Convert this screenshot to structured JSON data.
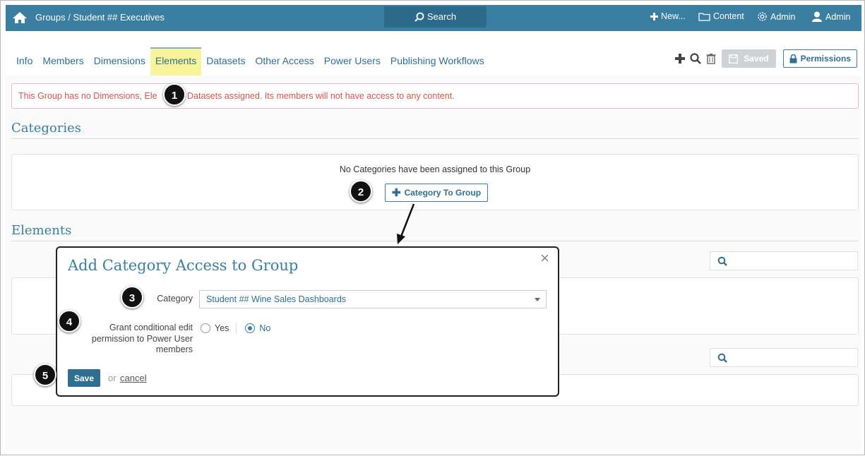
{
  "topbar": {
    "breadcrumb_root": "Groups",
    "breadcrumb_sep": " / ",
    "breadcrumb_current": "Student ## Executives",
    "search_label": "Search",
    "new_label": "New...",
    "content_label": "Content",
    "admin_label": "Admin",
    "user_label": "Admin"
  },
  "tabs": [
    {
      "label": "Info"
    },
    {
      "label": "Members"
    },
    {
      "label": "Dimensions"
    },
    {
      "label": "Elements"
    },
    {
      "label": "Datasets"
    },
    {
      "label": "Other Access"
    },
    {
      "label": "Power Users"
    },
    {
      "label": "Publishing Workflows"
    }
  ],
  "toolbar": {
    "saved_label": "Saved",
    "permissions_label": "Permissions"
  },
  "alert": {
    "text": "This Group has no Dimensions, Ele        or Datasets assigned. Its members will not have access to any content."
  },
  "categories": {
    "title": "Categories",
    "empty_text": "No Categories have been assigned to this Group",
    "add_button": "Category To Group"
  },
  "elements": {
    "title": "Elements"
  },
  "modal": {
    "title": "Add Category Access to Group",
    "category_label": "Category",
    "category_value": "Student ## Wine Sales Dashboards",
    "grant_label_1": "Grant conditional edit",
    "grant_label_2": "permission to Power User",
    "grant_label_3": "members",
    "yes_label": "Yes",
    "no_label": "No",
    "selected": "No",
    "save_label": "Save",
    "or_text": "or",
    "cancel_label": "cancel",
    "close_glyph": "×"
  },
  "callouts": [
    "1",
    "2",
    "3",
    "4",
    "5"
  ],
  "colors": {
    "brand": "#3a7ea1",
    "alert_text": "#d9534f",
    "active_tab": "#f7f49a",
    "save_button": "#2d6e91"
  },
  "icons": [
    "home-icon",
    "search-icon",
    "plus-icon",
    "folder-icon",
    "gear-icon",
    "user-icon",
    "trash-icon",
    "save-icon",
    "lock-icon",
    "close-icon",
    "caret-down-icon"
  ]
}
